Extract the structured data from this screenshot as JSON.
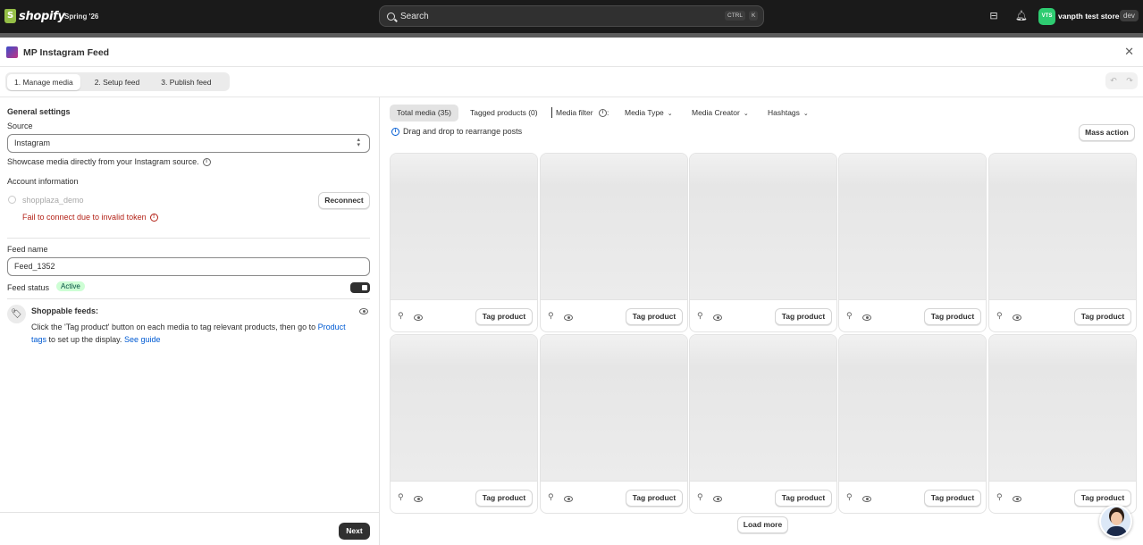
{
  "topbar": {
    "brand": "shopify",
    "edition": "Spring '26",
    "search_placeholder": "Search",
    "kbd_ctrl": "CTRL",
    "kbd_k": "K",
    "store_initials": "VTS",
    "store_name": "vanpth test store",
    "env_badge": "dev"
  },
  "app": {
    "title": "MP Instagram Feed",
    "steps": [
      "1. Manage media",
      "2. Setup feed",
      "3. Publish feed"
    ],
    "active_step": 0
  },
  "left": {
    "general_settings": "General settings",
    "source_label": "Source",
    "source_value": "Instagram",
    "source_hint": "Showcase media directly from your Instagram source.",
    "account_label": "Account information",
    "account_name": "shopplaza_demo",
    "reconnect": "Reconnect",
    "error": "Fail to connect due to invalid token",
    "feed_name_label": "Feed name",
    "feed_name_value": "Feed_1352",
    "feed_status_label": "Feed status",
    "feed_status_badge": "Active",
    "shoppable_title": "Shoppable feeds:",
    "shoppable_text_1": "Click the 'Tag product' button on each media to tag relevant products, then go to",
    "shoppable_link_1": "Product tags",
    "shoppable_text_2": "to set up the display.",
    "shoppable_link_2": "See guide",
    "next": "Next"
  },
  "right": {
    "tab_total": "Total media (35)",
    "tab_tagged": "Tagged products (0)",
    "media_filter": "Media filter",
    "filter_colon": ":",
    "dd_type": "Media Type",
    "dd_creator": "Media Creator",
    "dd_hashtags": "Hashtags",
    "hint": "Drag and drop to rearrange posts",
    "mass_action": "Mass action",
    "tag_product": "Tag product",
    "load_more": "Load more"
  },
  "icons": {
    "search": "search-icon",
    "inbox": "inbox-icon",
    "bell": "bell-icon",
    "close": "close-icon",
    "undo": "undo-icon",
    "redo": "redo-icon",
    "info": "info-icon",
    "pin": "pin-icon",
    "eye": "eye-icon",
    "tag": "tag-icon"
  },
  "colors": {
    "accent": "#005bd3",
    "error": "#b42318",
    "active_badge_bg": "#cdfed4",
    "primary_button": "#303030"
  }
}
